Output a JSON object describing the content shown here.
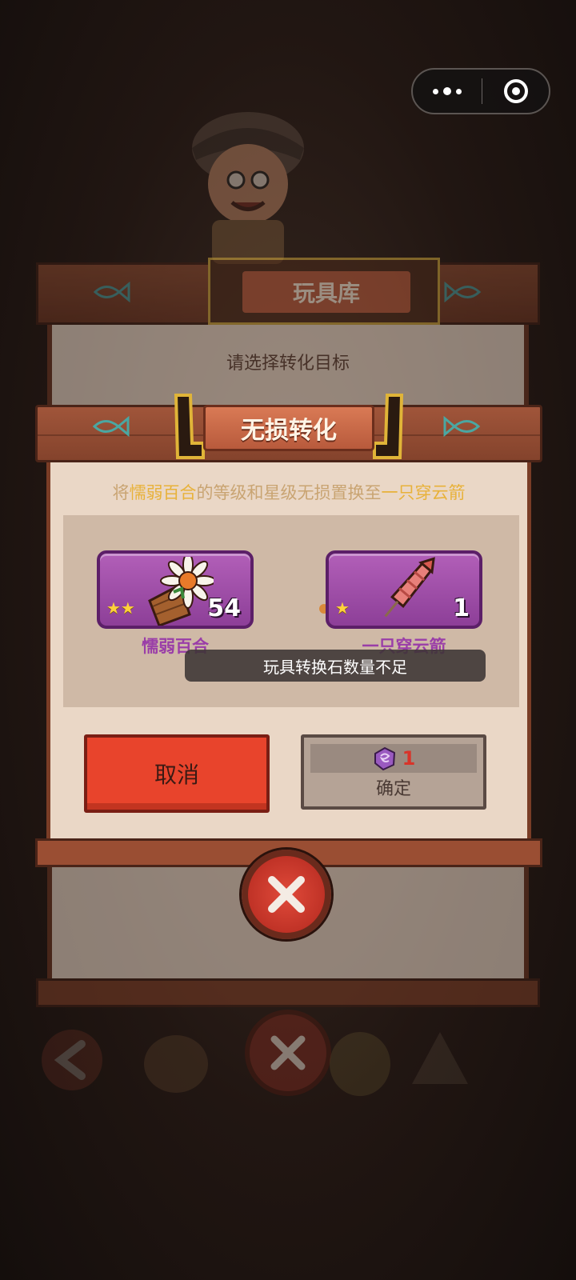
{
  "capsule": {
    "more_icon": "ellipsis-icon",
    "close_icon": "target-icon"
  },
  "background_panel": {
    "title": "玩具库",
    "subtitle": "请选择转化目标"
  },
  "dialog": {
    "title": "无损转化",
    "description": {
      "prefix": "将",
      "source_name": "懦弱百合",
      "middle": "的等级和星级无损置换至",
      "target_name": "一只穿云箭"
    },
    "source_item": {
      "name": "懦弱百合",
      "level": "54",
      "stars": "★★"
    },
    "target_item": {
      "name": "一只穿云箭",
      "level": "1",
      "stars": "★"
    },
    "toast": "玩具转换石数量不足",
    "cancel_label": "取消",
    "confirm_label": "确定",
    "cost_amount": "1",
    "cost_icon": "conversion-stone-icon",
    "close_icon": "close-x-icon"
  },
  "colors": {
    "highlight": "#e8b23a",
    "item_card": "#9a4aa6",
    "cancel": "#e8442c",
    "cost": "#d8342a"
  }
}
